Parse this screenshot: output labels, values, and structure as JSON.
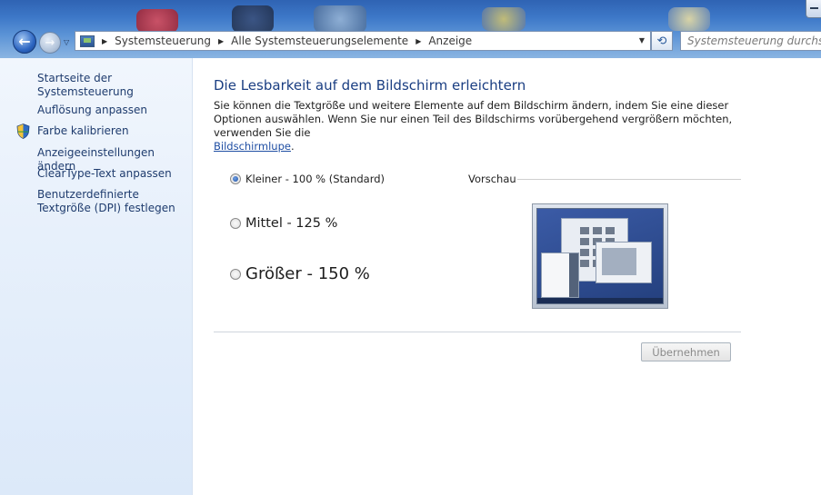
{
  "nav": {
    "back_glyph": "←",
    "forward_glyph": "→",
    "history_glyph": "▽"
  },
  "address": {
    "breadcrumbs": [
      "Systemsteuerung",
      "Alle Systemsteuerungselemente",
      "Anzeige"
    ],
    "separator_glyph": "▶",
    "dropdown_glyph": "▼",
    "refresh_glyph": "⟲"
  },
  "search": {
    "placeholder": "Systemsteuerung durchsuchen"
  },
  "sidebar": {
    "home_label": "Startseite der Systemsteuerung",
    "items": [
      {
        "label": "Auflösung anpassen",
        "icon": null
      },
      {
        "label": "Farbe kalibrieren",
        "icon": "shield-icon"
      },
      {
        "label": "Anzeigeeinstellungen ändern",
        "icon": null
      },
      {
        "label": "ClearType-Text anpassen",
        "icon": null
      },
      {
        "label": "Benutzerdefinierte Textgröße (DPI) festlegen",
        "icon": null
      }
    ]
  },
  "main": {
    "title": "Die Lesbarkeit auf dem Bildschirm erleichtern",
    "description": "Sie können die Textgröße und weitere Elemente auf dem Bildschirm ändern, indem Sie eine dieser Optionen auswählen. Wenn Sie nur einen Teil des Bildschirms vorübergehend vergrößern möchten, verwenden Sie die",
    "link_label": "Bildschirmlupe",
    "link_suffix": ".",
    "options": [
      {
        "label": "Kleiner - 100 % (Standard)",
        "selected": true
      },
      {
        "label": "Mittel - 125 %",
        "selected": false
      },
      {
        "label": "Größer - 150 %",
        "selected": false
      }
    ],
    "preview_label": "Vorschau",
    "apply_label": "Übernehmen"
  },
  "colors": {
    "title": "#1a3e82",
    "link": "#1f3c6e",
    "sidebar_bg": "#e7f0fb"
  }
}
